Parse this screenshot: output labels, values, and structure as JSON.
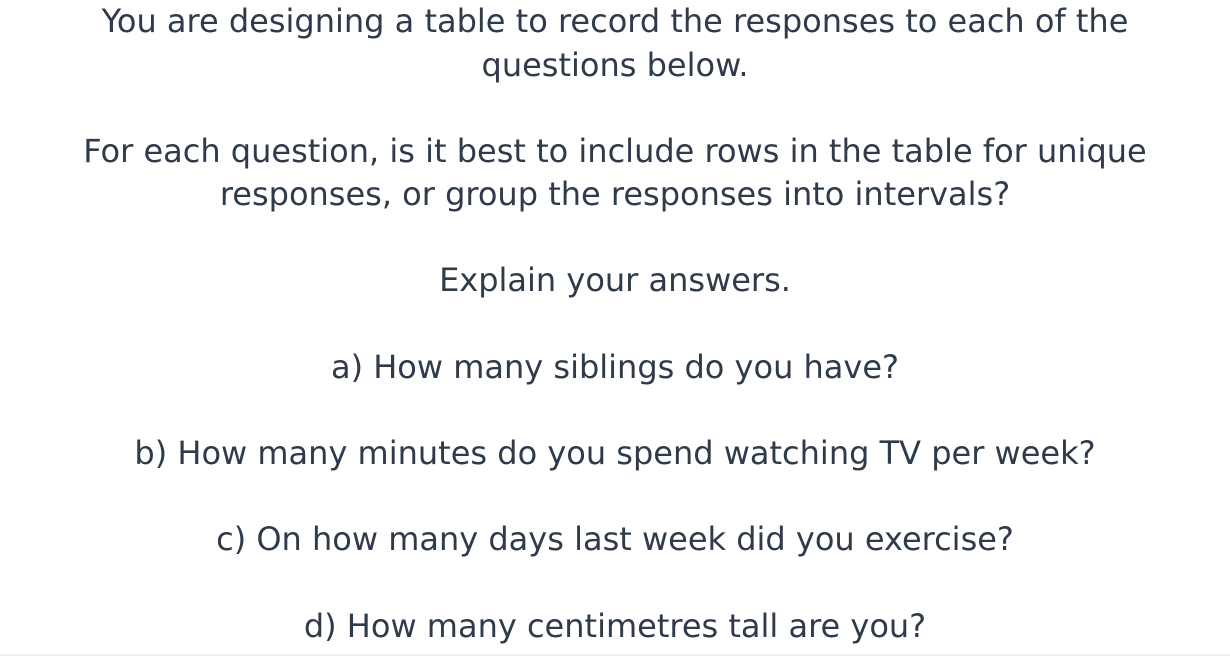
{
  "intro": {
    "line1": "You are designing a table to record the responses to each of the",
    "line2": "questions below."
  },
  "instruction": {
    "line1": "For each question, is it best to include rows in the table for unique",
    "line2": "responses, or group the responses into intervals?"
  },
  "explain": "Explain your answers.",
  "questions": [
    "a) How many siblings do you have?",
    "b) How many minutes do you spend watching TV per week?",
    "c) On how many days last week did you exercise?",
    "d) How many centimetres tall are you?"
  ]
}
